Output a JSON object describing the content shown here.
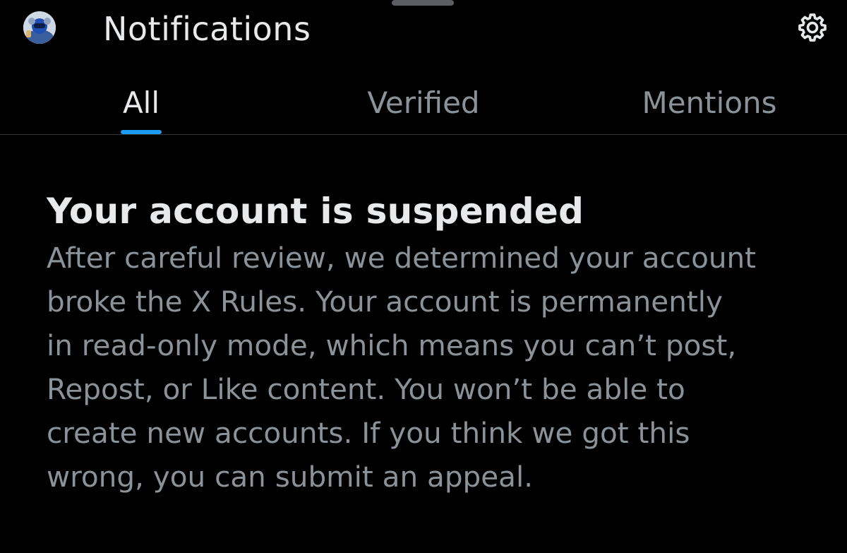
{
  "header": {
    "title": "Notifications",
    "avatar_icon": "avatar",
    "settings_icon": "gear-icon"
  },
  "tabs": [
    {
      "label": "All",
      "active": true
    },
    {
      "label": "Verified",
      "active": false
    },
    {
      "label": "Mentions",
      "active": false
    }
  ],
  "notice": {
    "title": "Your account is suspended",
    "body_lines": [
      "After careful review, we determined your account",
      "broke the X Rules. Your account is permanently",
      "in read-only mode, which means you can’t post,",
      "Repost, or Like content. You won’t be able to",
      "create new accounts. If you think we got this",
      "wrong, you can submit an appeal."
    ]
  },
  "colors": {
    "background": "#000000",
    "primary_text": "#e7e9ea",
    "secondary_text": "#8b9298",
    "accent": "#1d9bf0",
    "divider": "#2f3336"
  }
}
